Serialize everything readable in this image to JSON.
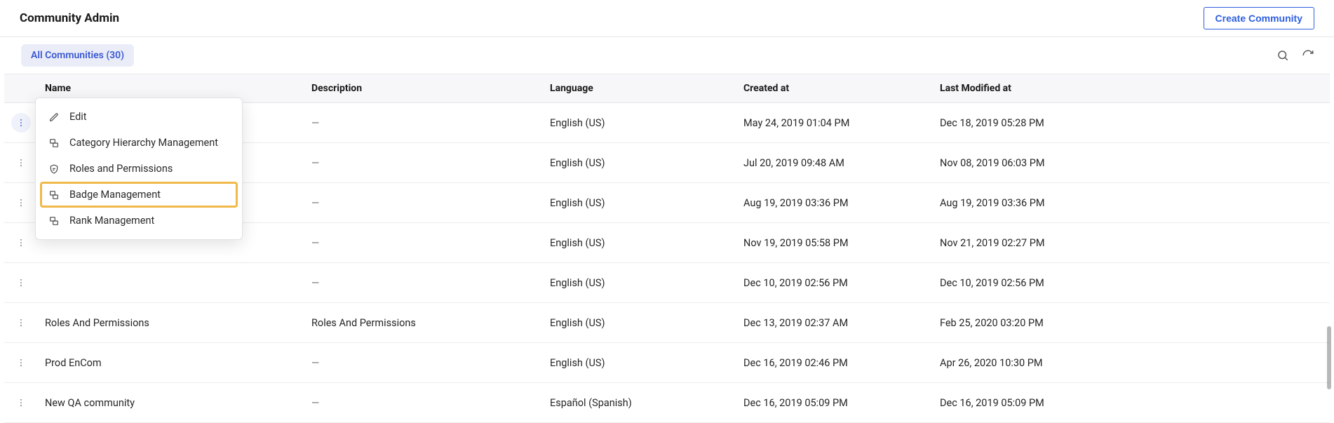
{
  "header": {
    "title": "Community Admin",
    "create_button": "Create Community"
  },
  "toolbar": {
    "filter_chip": "All Communities (30)"
  },
  "columns": {
    "name": "Name",
    "description": "Description",
    "language": "Language",
    "created": "Created at",
    "modified": "Last Modified at"
  },
  "rows": [
    {
      "name": "",
      "description": "—",
      "language": "English (US)",
      "created": "May 24, 2019 01:04 PM",
      "modified": "Dec 18, 2019 05:28 PM"
    },
    {
      "name": "",
      "description": "—",
      "language": "English (US)",
      "created": "Jul 20, 2019 09:48 AM",
      "modified": "Nov 08, 2019 06:03 PM"
    },
    {
      "name": "",
      "description": "—",
      "language": "English (US)",
      "created": "Aug 19, 2019 03:36 PM",
      "modified": "Aug 19, 2019 03:36 PM"
    },
    {
      "name": "",
      "description": "—",
      "language": "English (US)",
      "created": "Nov 19, 2019 05:58 PM",
      "modified": "Nov 21, 2019 02:27 PM"
    },
    {
      "name": "",
      "description": "—",
      "language": "English (US)",
      "created": "Dec 10, 2019 02:56 PM",
      "modified": "Dec 10, 2019 02:56 PM"
    },
    {
      "name": "Roles And Permissions",
      "description": "Roles And Permissions",
      "language": "English (US)",
      "created": "Dec 13, 2019 02:37 AM",
      "modified": "Feb 25, 2020 03:20 PM"
    },
    {
      "name": "Prod EnCom",
      "description": "—",
      "language": "English (US)",
      "created": "Dec 16, 2019 02:46 PM",
      "modified": "Apr 26, 2020 10:30 PM"
    },
    {
      "name": "New QA community",
      "description": "—",
      "language": "Español (Spanish)",
      "created": "Dec 16, 2019 05:09 PM",
      "modified": "Dec 16, 2019 05:09 PM"
    }
  ],
  "context_menu": {
    "items": [
      {
        "icon": "pencil-icon",
        "label": "Edit"
      },
      {
        "icon": "hierarchy-icon",
        "label": "Category Hierarchy Management"
      },
      {
        "icon": "shield-icon",
        "label": "Roles and Permissions"
      },
      {
        "icon": "badge-icon",
        "label": "Badge Management",
        "highlighted": true
      },
      {
        "icon": "rank-icon",
        "label": "Rank Management"
      }
    ]
  }
}
